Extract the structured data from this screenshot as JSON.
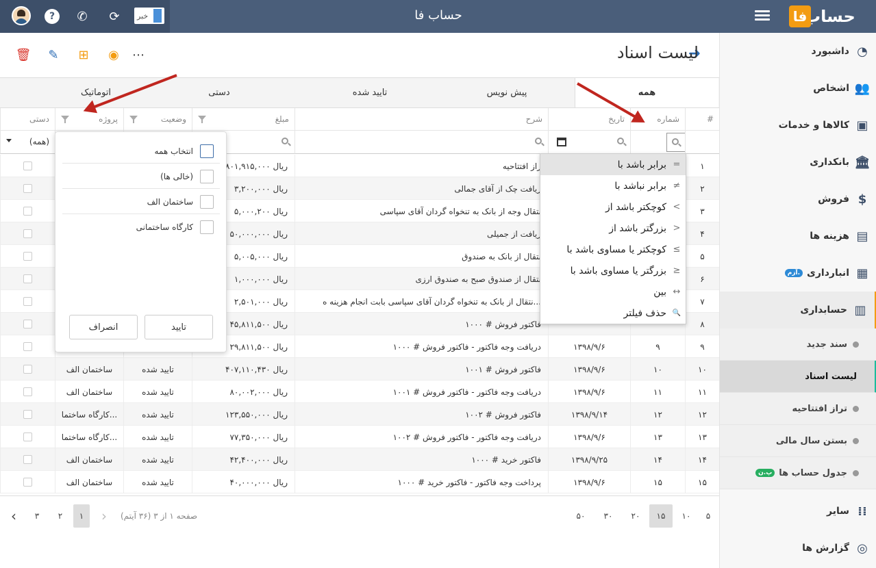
{
  "app": {
    "title": "حساب فا",
    "logo_text": "حساب",
    "logo_mark": "فا"
  },
  "topbar": {
    "news_label": "خبر"
  },
  "page": {
    "title": "لیست اسناد"
  },
  "sidebar": {
    "items": [
      {
        "label": "داشبورد"
      },
      {
        "label": "اشخاص"
      },
      {
        "label": "کالاها و خدمات"
      },
      {
        "label": "بانکداری"
      },
      {
        "label": "فروش"
      },
      {
        "label": "هزینه ها"
      },
      {
        "label": "انبارداری",
        "badge": "آزم."
      },
      {
        "label": "حسابداری"
      },
      {
        "label": "سایر"
      },
      {
        "label": "گزارش ها"
      }
    ],
    "sub_items": [
      {
        "label": "سند جدید"
      },
      {
        "label": "لیست اسناد"
      },
      {
        "label": "تراز افتتاحیه"
      },
      {
        "label": "بستن سال مالی"
      },
      {
        "label": "جدول حساب ها",
        "badge": "پ.ن"
      }
    ]
  },
  "tabs": [
    "همه",
    "پیش نویس",
    "تایید شده",
    "دستی",
    "اتوماتیک"
  ],
  "columns": [
    "#",
    "شماره",
    "تاریخ",
    "شرح",
    "مبلغ",
    "وضعیت",
    "پروژه",
    "دستی"
  ],
  "filters": {
    "manual_select": "(همه)"
  },
  "rows": [
    {
      "idx": "۱",
      "num": "",
      "date": "",
      "desc": "راز افتتاحیه",
      "amount": "۸۰۱,۹۱۵,۰۰۰ ریال",
      "status": "",
      "project": ""
    },
    {
      "idx": "۲",
      "num": "",
      "date": "",
      "desc": "ریافت چک از آقای جمالی",
      "amount": "۳,۲۰۰,۰۰۰ ریال",
      "status": "",
      "project": ""
    },
    {
      "idx": "۳",
      "num": "",
      "date": "",
      "desc": "نتقال وجه از بانک به تنخواه گردان آقای سپاسی",
      "amount": "۵,۰۰۰,۲۰۰ ریال",
      "status": "",
      "project": ""
    },
    {
      "idx": "۴",
      "num": "",
      "date": "",
      "desc": "ریافت از جمیلی",
      "amount": "۵۰,۰۰۰,۰۰۰ ریال",
      "status": "",
      "project": ""
    },
    {
      "idx": "۵",
      "num": "",
      "date": "",
      "desc": "نتقال از بانک به صندوق",
      "amount": "۵,۰۰۵,۰۰۰ ریال",
      "status": "",
      "project": ""
    },
    {
      "idx": "۶",
      "num": "",
      "date": "",
      "desc": "نتقال از صندوق صبح به صندوق ارزی",
      "amount": "۱,۰۰۰,۰۰۰ ریال",
      "status": "",
      "project": ""
    },
    {
      "idx": "۷",
      "num": "",
      "date": "",
      "desc": "نتقال از بانک به تنخواه گردان آقای سپاسی بابت انجام هزینه ه...",
      "amount": "۲,۵۰۱,۰۰۰ ریال",
      "status": "",
      "project": ""
    },
    {
      "idx": "۸",
      "num": "",
      "date": "",
      "desc": "فاکتور فروش # ۱۰۰۰",
      "amount": "۴۵,۸۱۱,۵۰۰ ریال",
      "status": "",
      "project": ""
    },
    {
      "idx": "۹",
      "num": "۹",
      "date": "۱۳۹۸/۹/۶",
      "desc": "دریافت وجه فاکتور - فاکتور فروش # ۱۰۰۰",
      "amount": "۲۹,۸۱۱,۵۰۰ ریال",
      "status": "",
      "project": ""
    },
    {
      "idx": "۱۰",
      "num": "۱۰",
      "date": "۱۳۹۸/۹/۶",
      "desc": "فاکتور فروش # ۱۰۰۱",
      "amount": "۴۰۷,۱۱۰,۴۳۰ ریال",
      "status": "تایید شده",
      "project": "ساختمان الف"
    },
    {
      "idx": "۱۱",
      "num": "۱۱",
      "date": "۱۳۹۸/۹/۶",
      "desc": "دریافت وجه فاکتور - فاکتور فروش # ۱۰۰۱",
      "amount": "۸۰,۰۰۲,۰۰۰ ریال",
      "status": "تایید شده",
      "project": "ساختمان الف"
    },
    {
      "idx": "۱۲",
      "num": "۱۲",
      "date": "۱۳۹۸/۹/۱۴",
      "desc": "فاکتور فروش # ۱۰۰۲",
      "amount": "۱۲۳,۵۵۰,۰۰۰ ریال",
      "status": "تایید شده",
      "project": "کارگاه ساختما..."
    },
    {
      "idx": "۱۳",
      "num": "۱۳",
      "date": "۱۳۹۸/۹/۶",
      "desc": "دریافت وجه فاکتور - فاکتور فروش # ۱۰۰۲",
      "amount": "۷۷,۳۵۰,۰۰۰ ریال",
      "status": "تایید شده",
      "project": "کارگاه ساختما..."
    },
    {
      "idx": "۱۴",
      "num": "۱۴",
      "date": "۱۳۹۸/۹/۲۵",
      "desc": "فاکتور خرید # ۱۰۰۰",
      "amount": "۴۲,۴۰۰,۰۰۰ ریال",
      "status": "تایید شده",
      "project": "ساختمان الف"
    },
    {
      "idx": "۱۵",
      "num": "۱۵",
      "date": "۱۳۹۸/۹/۶",
      "desc": "پرداخت وجه فاکتور - فاکتور خرید # ۱۰۰۰",
      "amount": "۴۰,۰۰۰,۰۰۰ ریال",
      "status": "تایید شده",
      "project": "ساختمان الف"
    }
  ],
  "pager": {
    "info": "صفحه ۱ از ۳ (۳۶ آیتم)",
    "pages": [
      "۱",
      "۲",
      "۳"
    ],
    "current_page": "۱",
    "sizes": [
      "۵",
      "۱۰",
      "۱۵",
      "۲۰",
      "۳۰",
      "۵۰"
    ],
    "current_size": "۱۵"
  },
  "project_filter": {
    "options": [
      "انتخاب همه",
      "(خالی ها)",
      "ساختمان الف",
      "کارگاه ساختمانی"
    ],
    "ok_label": "تایید",
    "cancel_label": "انصراف"
  },
  "operators": [
    {
      "label": "برابر باشد با",
      "sym": "="
    },
    {
      "label": "برابر نباشد با",
      "sym": "≠"
    },
    {
      "label": "کوچکتر باشد از",
      "sym": "<"
    },
    {
      "label": "بزرگتر باشد از",
      "sym": ">"
    },
    {
      "label": "کوچکتر یا مساوی باشد با",
      "sym": "≤"
    },
    {
      "label": "بزرگتر یا مساوی باشد با",
      "sym": "≥"
    },
    {
      "label": "بین",
      "sym": "↔"
    },
    {
      "label": "حذف فیلتر",
      "sym": "🔍"
    }
  ],
  "colors": {
    "topbar": "#4a5e7a",
    "accent": "#f39c12",
    "arrow": "#c0261f"
  }
}
